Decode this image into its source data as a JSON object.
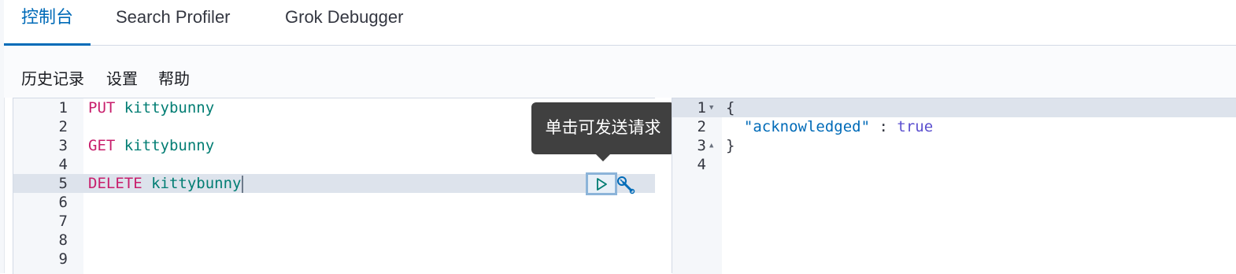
{
  "tabs": [
    {
      "label": "控制台",
      "active": true
    },
    {
      "label": "Search Profiler",
      "active": false
    },
    {
      "label": "Grok Debugger",
      "active": false
    }
  ],
  "menu": {
    "history": "历史记录",
    "settings": "设置",
    "help": "帮助"
  },
  "editor": {
    "line_numbers": [
      "1",
      "2",
      "3",
      "4",
      "5",
      "6",
      "7",
      "8",
      "9"
    ],
    "lines": [
      {
        "method": "PUT",
        "path": "kittybunny"
      },
      {
        "method": "",
        "path": ""
      },
      {
        "method": "GET",
        "path": "kittybunny"
      },
      {
        "method": "",
        "path": ""
      },
      {
        "method": "DELETE",
        "path": "kittybunny"
      },
      {
        "method": "",
        "path": ""
      },
      {
        "method": "",
        "path": ""
      },
      {
        "method": "",
        "path": ""
      },
      {
        "method": "",
        "path": ""
      }
    ],
    "active_line": 5
  },
  "tooltip": {
    "text": "单击可发送请求"
  },
  "icons": {
    "send": "play-icon",
    "wrench": "wrench-icon"
  },
  "output": {
    "line_numbers": [
      "1",
      "2",
      "3",
      "4"
    ],
    "brace_open": "{",
    "key": "\"acknowledged\"",
    "colon": " : ",
    "value": "true",
    "brace_close": "}"
  },
  "colors": {
    "accent": "#006bb8",
    "keyword": "#c81e6c",
    "index": "#017d73",
    "boolean": "#5b4fcf"
  }
}
